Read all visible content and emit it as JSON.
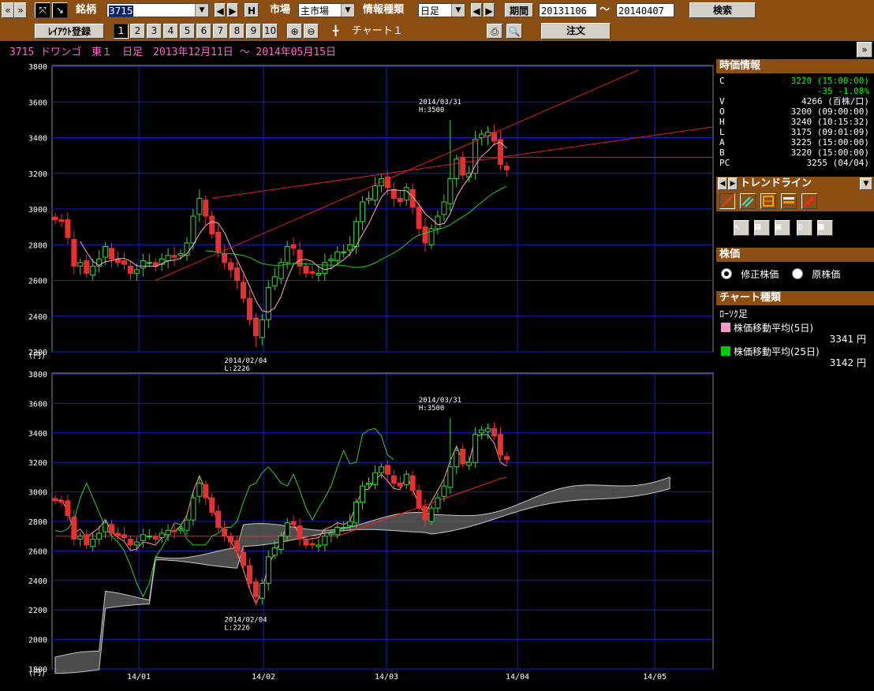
{
  "toolbar": {
    "ticker_label": "銘柄",
    "ticker_value": "3715",
    "h_label": "H",
    "market_label": "市場",
    "market_value": "主市場",
    "info_type_label": "情報種類",
    "info_type_value": "日足",
    "period_label": "期間",
    "period_from": "20131106",
    "period_sep": "～",
    "period_to": "20140407",
    "search_button": "検索",
    "layout_button": "ﾚｲｱｳﾄ登録",
    "layout_numbers": [
      "1",
      "2",
      "3",
      "4",
      "5",
      "6",
      "7",
      "8",
      "9",
      "10"
    ],
    "active_layout": "1",
    "chart_name": "チャート１",
    "order_button": "注文",
    "icons": [
      "nav-prev-icon",
      "nav-next-icon",
      "cursor-icon",
      "pen-icon",
      "zoom-in-icon",
      "zoom-out-icon",
      "crosshair-icon",
      "print-icon",
      "preview-icon",
      "panel-toggle-icon"
    ]
  },
  "chart_title": "3715 ドワンゴ　東１　日足　2013年12月11日 ～ 2014年05月15日",
  "side_panel": {
    "quote_header": "時価情報",
    "quote_rows": [
      {
        "key": "C",
        "value": "3220 (15:00:00)",
        "color": "green"
      },
      {
        "key": "",
        "value": "-35 -1.08%",
        "color": "green"
      },
      {
        "key": "V",
        "value": "4266 (百株/口)",
        "color": "white"
      },
      {
        "key": "O",
        "value": "3200 (09:00:00)",
        "color": "white"
      },
      {
        "key": "H",
        "value": "3240 (10:15:32)",
        "color": "white"
      },
      {
        "key": "L",
        "value": "3175 (09:01:09)",
        "color": "white"
      },
      {
        "key": "A",
        "value": "3225 (15:00:00)",
        "color": "white"
      },
      {
        "key": "B",
        "value": "3220 (15:00:00)",
        "color": "white"
      },
      {
        "key": "PC",
        "value": "3255 (04/04)",
        "color": "white"
      }
    ],
    "trendline_header": "トレンドライン",
    "price_header": "株価",
    "price_options": [
      "修正株価",
      "原株価"
    ],
    "price_selected": "修正株価",
    "chart_type_header": "チャート種類",
    "chart_type_name": "ﾛｰｿｸ足",
    "ma_items": [
      {
        "label": "株価移動平均(5日)",
        "value": "3341 円",
        "color": "#ff99cc"
      },
      {
        "label": "株価移動平均(25日)",
        "value": "3142 円",
        "color": "#00cc00"
      }
    ]
  },
  "chart_data": [
    {
      "type": "candlestick",
      "title": "",
      "ylabel": "(円)",
      "ylim": [
        2200,
        3800
      ],
      "yticks": [
        2200,
        2400,
        2600,
        2800,
        3000,
        3200,
        3400,
        3600,
        3800
      ],
      "xticks": [
        "14/01",
        "14/02",
        "14/03",
        "14/04",
        "14/05"
      ],
      "annotations": [
        {
          "date": "2014/03/31",
          "label": "2014/03/31\nH:3500"
        },
        {
          "date": "2014/02/04",
          "label": "2014/02/04\nL:2226"
        }
      ],
      "series": [
        {
          "name": "株価移動平均(5日)",
          "color": "#ff99cc"
        },
        {
          "name": "株価移動平均(25日)",
          "color": "#00cc00"
        }
      ],
      "closes": [
        2940,
        2930,
        2840,
        2680,
        2700,
        2640,
        2680,
        2720,
        2790,
        2720,
        2700,
        2690,
        2640,
        2660,
        2710,
        2700,
        2680,
        2720,
        2740,
        2730,
        2750,
        2810,
        2960,
        3060,
        2960,
        2860,
        2760,
        2700,
        2660,
        2600,
        2500,
        2380,
        2290,
        2380,
        2560,
        2620,
        2700,
        2790,
        2780,
        2680,
        2640,
        2640,
        2640,
        2700,
        2720,
        2760,
        2760,
        2800,
        2930,
        3040,
        3060,
        3130,
        3170,
        3120,
        3060,
        3040,
        3120,
        3010,
        2890,
        2810,
        2890,
        2960,
        3040,
        3170,
        3280,
        3190,
        3200,
        3390,
        3420,
        3430,
        3380,
        3250,
        3220
      ]
    },
    {
      "type": "candlestick",
      "title": "",
      "ylabel": "(円)",
      "ylim": [
        1800,
        3800
      ],
      "yticks": [
        1800,
        2000,
        2200,
        2400,
        2600,
        2800,
        3000,
        3200,
        3400,
        3600,
        3800
      ],
      "xticks": [
        "14/01",
        "14/02",
        "14/03",
        "14/04",
        "14/05"
      ],
      "annotations": [
        {
          "date": "2014/03/31",
          "label": "2014/03/31\nH:3500"
        },
        {
          "date": "2014/02/04",
          "label": "2014/02/04\nL:2226"
        }
      ],
      "series": [
        {
          "name": "cloud",
          "color": "#ffffff"
        }
      ]
    }
  ]
}
